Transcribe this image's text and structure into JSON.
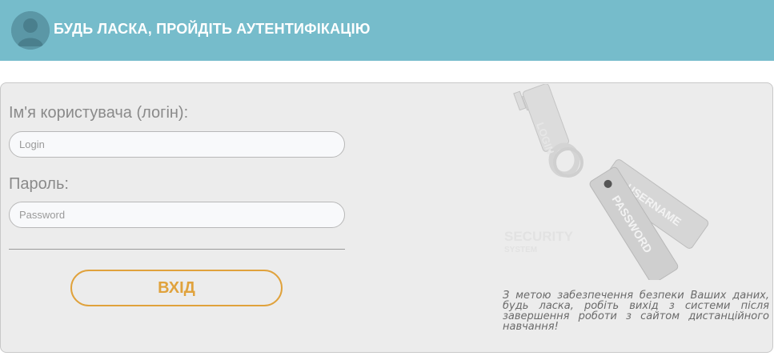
{
  "header": {
    "title": "БУДЬ ЛАСКА, ПРОЙДІТЬ АУТЕНТИФІКАЦІЮ",
    "background": "#76bccb",
    "avatar_icon": "user-avatar-icon"
  },
  "form": {
    "username_label": "Ім'я користувача (логін):",
    "username_placeholder": "Login",
    "username_value": "",
    "password_label": "Пароль:",
    "password_placeholder": "Password",
    "password_value": "",
    "submit_label": "ВХІД",
    "accent": "#e0a23c"
  },
  "illustration": {
    "tag_username": "USERNAME",
    "tag_password": "PASSWORD",
    "key_text": "LOGIN",
    "brand_title": "SECURITY",
    "brand_subtitle": "SYSTEM",
    "icon": "keys-with-tags-icon"
  },
  "notice": {
    "text": "З метою забезпечення безпеки Ваших даних, будь ласка, робіть вихід з системи після завершення роботи з сайтом дистанційного навчання!"
  }
}
